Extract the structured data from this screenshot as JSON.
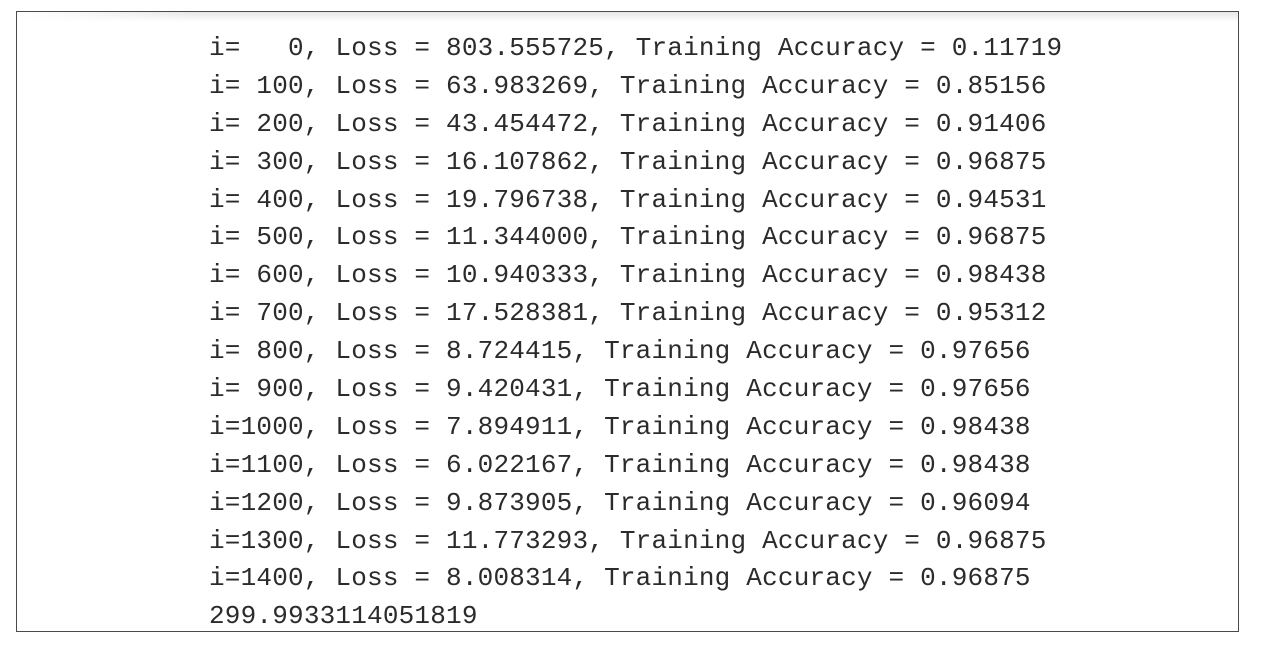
{
  "output": {
    "lines": [
      "i=   0, Loss = 803.555725, Training Accuracy = 0.11719",
      "i= 100, Loss = 63.983269, Training Accuracy = 0.85156",
      "i= 200, Loss = 43.454472, Training Accuracy = 0.91406",
      "i= 300, Loss = 16.107862, Training Accuracy = 0.96875",
      "i= 400, Loss = 19.796738, Training Accuracy = 0.94531",
      "i= 500, Loss = 11.344000, Training Accuracy = 0.96875",
      "i= 600, Loss = 10.940333, Training Accuracy = 0.98438",
      "i= 700, Loss = 17.528381, Training Accuracy = 0.95312",
      "i= 800, Loss = 8.724415, Training Accuracy = 0.97656",
      "i= 900, Loss = 9.420431, Training Accuracy = 0.97656",
      "i=1000, Loss = 7.894911, Training Accuracy = 0.98438",
      "i=1100, Loss = 6.022167, Training Accuracy = 0.98438",
      "i=1200, Loss = 9.873905, Training Accuracy = 0.96094",
      "i=1300, Loss = 11.773293, Training Accuracy = 0.96875",
      "i=1400, Loss = 8.008314, Training Accuracy = 0.96875",
      "299.9933114051819"
    ]
  },
  "colors": {
    "text": "#2b2b2b",
    "border": "#4a4a4a",
    "background": "#ffffff"
  }
}
